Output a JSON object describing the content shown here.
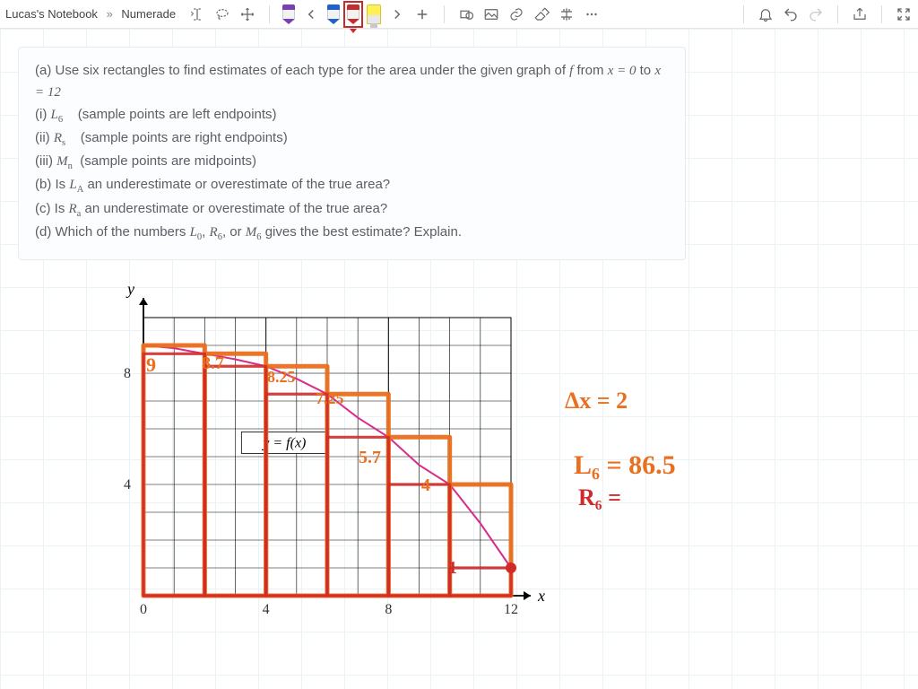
{
  "breadcrumb": {
    "notebook": "Lucas's Notebook",
    "sep": "»",
    "page": "Numerade"
  },
  "problem": {
    "a_lead": "(a) Use six rectangles to find estimates of each type for the area under the given graph of ",
    "a_tail1": " from ",
    "a_tail2": " to ",
    "f": "f",
    "x0": "x = 0",
    "x1": "x = 12",
    "i": "(i) ",
    "i_sym": "L",
    "i_sub": "6",
    "i_txt": "(sample points are left endpoints)",
    "ii": "(ii) ",
    "ii_sym": "R",
    "ii_sub": "s",
    "ii_txt": "(sample points are right endpoints)",
    "iii": "(iii) ",
    "iii_sym": "M",
    "iii_sub": "n",
    "iii_txt": "(sample points are midpoints)",
    "b": "(b) Is ",
    "b_sym": "L",
    "b_sub": "A",
    "b_txt": " an underestimate or overestimate of the true area?",
    "c": "(c) Is ",
    "c_sym": "R",
    "c_sub": "a",
    "c_txt": " an underestimate or overestimate of the true area?",
    "d_lead": "(d) Which of the numbers ",
    "d_L": "L",
    "d_Ls": "0",
    "d_R": "R",
    "d_Rs": "6",
    "d_M": "M",
    "d_Ms": "6",
    "d_tail": " gives the best estimate? Explain.",
    "comma": ", ",
    "or": ", or "
  },
  "chart_data": {
    "type": "line",
    "title": "",
    "xlabel": "x",
    "ylabel": "y",
    "xlim": [
      0,
      12
    ],
    "ylim": [
      0,
      10
    ],
    "xticks": [
      0,
      4,
      8,
      12
    ],
    "yticks": [
      4,
      8
    ],
    "curve_label": "y = f(x)",
    "series": [
      {
        "name": "f",
        "x": [
          0,
          1,
          2,
          3,
          4,
          5,
          6,
          7,
          8,
          9,
          10,
          11,
          12
        ],
        "y": [
          9.0,
          8.9,
          8.7,
          8.5,
          8.25,
          7.8,
          7.25,
          6.4,
          5.7,
          4.7,
          4.0,
          2.6,
          1.0
        ]
      }
    ],
    "left_rectangles": {
      "dx": 2,
      "heights": [
        9.0,
        8.7,
        8.25,
        7.25,
        5.7,
        4.0
      ]
    },
    "right_rectangles": {
      "dx": 2,
      "heights": [
        8.7,
        8.25,
        7.25,
        5.7,
        4.0,
        1.0
      ]
    },
    "marked_point": {
      "x": 12,
      "y": 1.0
    }
  },
  "handwriting": {
    "dx": "Δx = 2",
    "L6_lhs": "L₆ =",
    "L6_rhs": "86.5",
    "R6": "R₆ =",
    "v1": "9",
    "v2": "8.7",
    "v3": "8.25",
    "v4": "7.25",
    "v5": "5.7",
    "v6": "4",
    "v7": "1"
  }
}
